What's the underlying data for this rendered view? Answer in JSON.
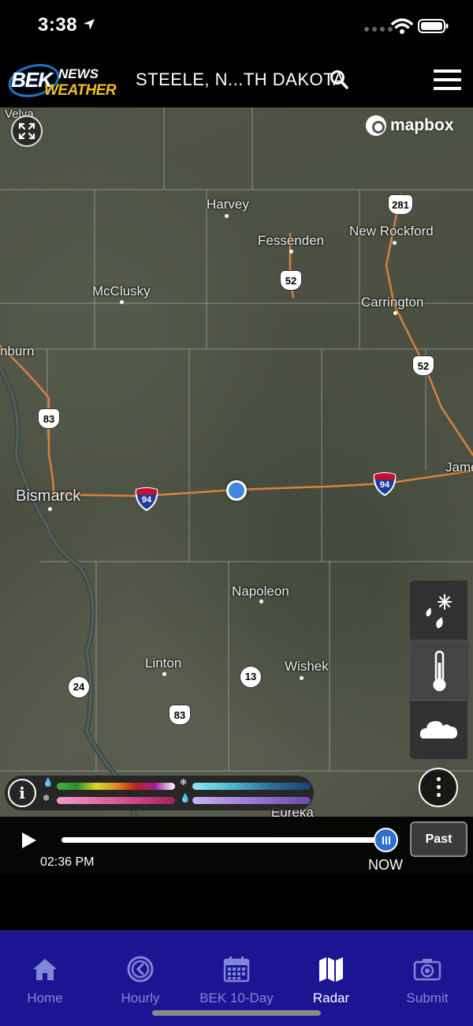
{
  "status_bar": {
    "time": "3:38"
  },
  "header": {
    "logo_primary": "BEK",
    "logo_news": "NEWS",
    "logo_weather": "WEATHER",
    "location": "STEELE, N...TH DAKOTA"
  },
  "map": {
    "attribution": "mapbox",
    "places": [
      {
        "name": "Velva"
      },
      {
        "name": "Harvey"
      },
      {
        "name": "Fessenden"
      },
      {
        "name": "New Rockford"
      },
      {
        "name": "McClusky"
      },
      {
        "name": "Carrington"
      },
      {
        "name": "nburn"
      },
      {
        "name": "Bismarck"
      },
      {
        "name": "Jame"
      },
      {
        "name": "Napoleon"
      },
      {
        "name": "Linton"
      },
      {
        "name": "Wishek"
      },
      {
        "name": "Eureka"
      }
    ],
    "shields": [
      {
        "type": "us",
        "number": "281"
      },
      {
        "type": "us",
        "number": "52"
      },
      {
        "type": "us",
        "number": "52"
      },
      {
        "type": "us",
        "number": "83"
      },
      {
        "type": "interstate",
        "number": "94"
      },
      {
        "type": "interstate",
        "number": "94"
      },
      {
        "type": "state",
        "number": "13"
      },
      {
        "type": "state",
        "number": "24"
      },
      {
        "type": "us",
        "number": "83"
      }
    ]
  },
  "layers": {
    "items": [
      {
        "name": "precipitation-type",
        "icon": "rain-snow-icon"
      },
      {
        "name": "temperature",
        "icon": "thermometer-icon"
      },
      {
        "name": "clouds",
        "icon": "cloud-icon"
      }
    ]
  },
  "legend": {
    "info_label": "i"
  },
  "timeline": {
    "time": "02:36 PM",
    "now_label": "NOW",
    "past_label": "Past",
    "progress": 1.0
  },
  "tabs": [
    {
      "label": "Home",
      "icon": "home-icon",
      "active": false
    },
    {
      "label": "Hourly",
      "icon": "clock-icon",
      "active": false
    },
    {
      "label": "BEK 10-Day",
      "icon": "calendar-icon",
      "active": false
    },
    {
      "label": "Radar",
      "icon": "map-icon",
      "active": true
    },
    {
      "label": "Submit",
      "icon": "camera-icon",
      "active": false
    }
  ],
  "colors": {
    "tab_bar": "#1c1593",
    "accent": "#2f6fd1",
    "weather_yellow": "#f2c01e"
  }
}
